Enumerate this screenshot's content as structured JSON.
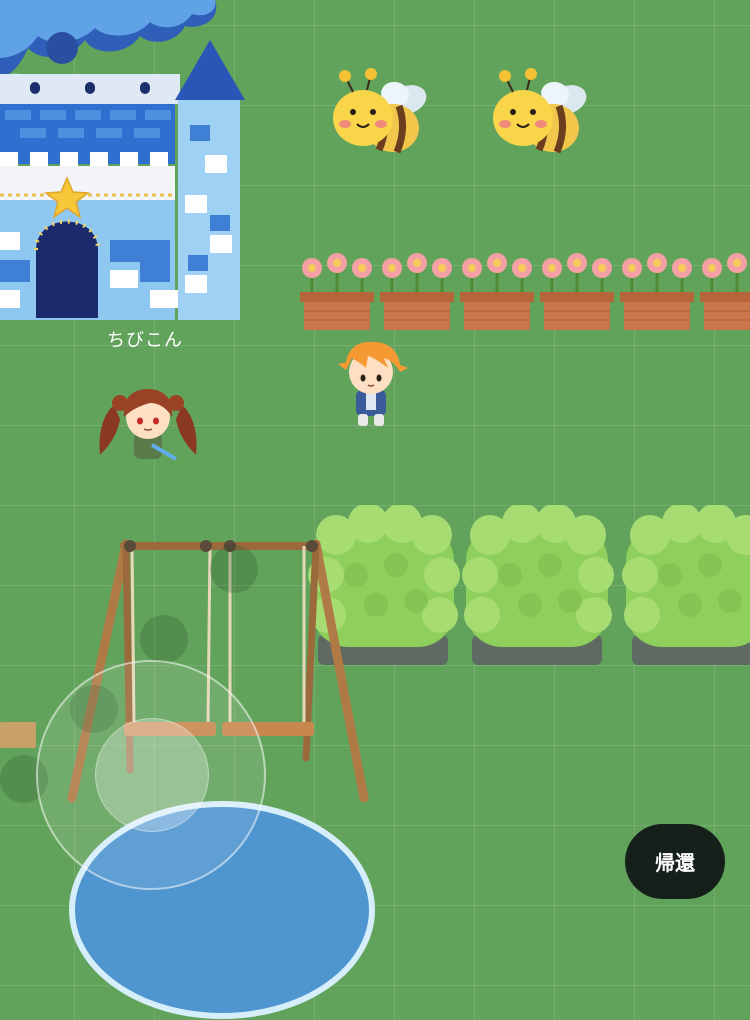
{
  "map": {
    "castle": {
      "name": "ちびこん",
      "icon": "castle-icon"
    },
    "return_button": {
      "label": "帰還"
    },
    "colors": {
      "grass": "#62a35c",
      "button_bg": "#16201b",
      "button_text": "#ffffff"
    },
    "objects": [
      "bee-icon",
      "bee-icon",
      "flower-planter-icon",
      "flower-planter-icon",
      "flower-planter-icon",
      "flower-planter-icon",
      "flower-planter-icon",
      "flower-planter-icon",
      "bush-icon",
      "bush-icon",
      "bush-icon",
      "swing-set-icon",
      "pond-icon"
    ],
    "characters": [
      "player-avatar",
      "other-avatar"
    ]
  }
}
